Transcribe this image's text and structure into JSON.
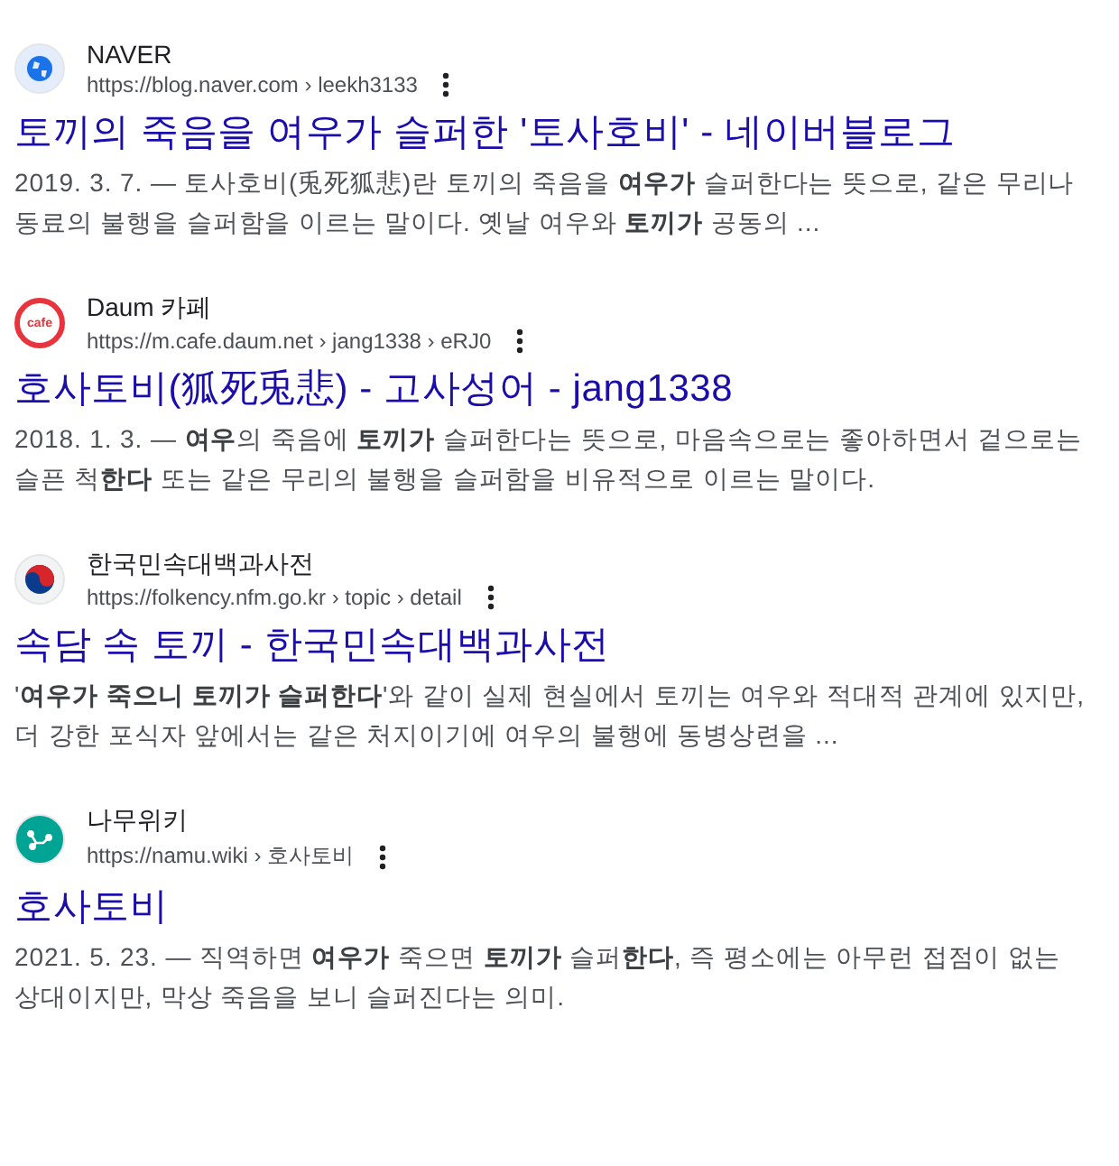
{
  "results": [
    {
      "kind": "globe",
      "site": "NAVER",
      "url": "https://blog.naver.com › leekh3133",
      "title": "토끼의 죽음을 여우가 슬퍼한 '토사호비' - 네이버블로그",
      "snippet": "2019. 3. 7. — 토사호비(兎死狐悲)란 토끼의 죽음을 **여우가** 슬퍼한다는 뜻으로, 같은 무리나 동료의 불행을 슬퍼함을 이르는 말이다. 옛날 여우와 **토끼가** 공동의 ..."
    },
    {
      "kind": "cafe",
      "logo_text": "cafe",
      "site": "Daum 카페",
      "url": "https://m.cafe.daum.net › jang1338 › eRJ0",
      "title": "호사토비(狐死兎悲) - 고사성어 - jang1338",
      "snippet": "2018. 1. 3. — **여우**의 죽음에 **토끼가** 슬퍼한다는 뜻으로, 마음속으로는 좋아하면서 겉으로는 슬픈 척**한다** 또는 같은 무리의 불행을 슬퍼함을 비유적으로 이르는 말이다."
    },
    {
      "kind": "taegeuk",
      "site": "한국민속대백과사전",
      "url": "https://folkency.nfm.go.kr › topic › detail",
      "title": "속담 속 토끼 - 한국민속대백과사전",
      "snippet": "'**여우가 죽으니 토끼가 슬퍼한다**'와 같이 실제 현실에서 토끼는 여우와 적대적 관계에 있지만, 더 강한 포식자 앞에서는 같은 처지이기에 여우의 불행에 동병상련을 ..."
    },
    {
      "kind": "namu",
      "site": "나무위키",
      "url": "https://namu.wiki › 호사토비",
      "title": "호사토비",
      "snippet": "2021. 5. 23. — 직역하면 **여우가** 죽으면 **토끼가** 슬퍼**한다**, 즉 평소에는 아무런 접점이 없는 상대이지만, 막상 죽음을 보니 슬퍼진다는 의미."
    }
  ]
}
